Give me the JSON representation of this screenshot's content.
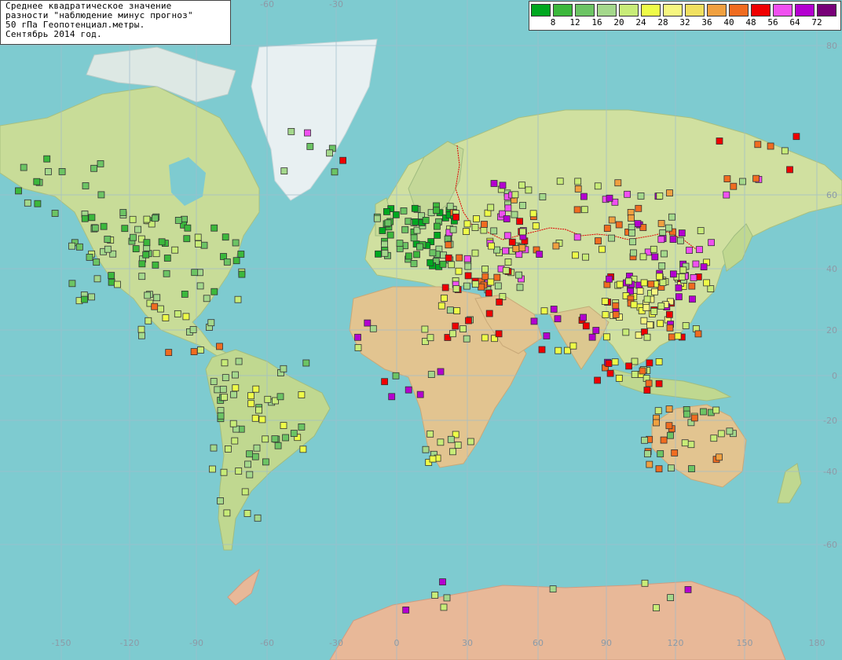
{
  "title": {
    "lines": [
      "Среднее квадратическое значение",
      "разности \"наблюдение минус прогноз\"",
      "50 гПа Геопотенциал.метры.",
      "Сентябрь 2014 год."
    ]
  },
  "legend": {
    "colors": [
      "#00a820",
      "#3cb83c",
      "#6cc464",
      "#a4d88c",
      "#c8ec78",
      "#eefc48",
      "#f6f680",
      "#f0e060",
      "#f0a040",
      "#f06c20",
      "#f00000",
      "#f050f0",
      "#b400d0",
      "#780078"
    ],
    "labels": [
      "8",
      "12",
      "16",
      "20",
      "24",
      "28",
      "32",
      "36",
      "40",
      "48",
      "56",
      "64",
      "72"
    ]
  },
  "axes": {
    "lon_labels": [
      "-150",
      "-120",
      "-90",
      "-60",
      "-30",
      "0",
      "30",
      "60",
      "90",
      "120",
      "150",
      "180"
    ],
    "lat_labels": [
      "80",
      "60",
      "40",
      "20",
      "0",
      "-20",
      "-40",
      "-60"
    ],
    "top_lon_labels": [
      "-60",
      "-30"
    ]
  },
  "colors": {
    "ocean": "#7ecbd0",
    "land": "#e8c48a",
    "highland": "#e4a890",
    "lowland": "#a8d890",
    "ice": "#e8f2f4",
    "border": "#e00000",
    "grid": "#9fbccc"
  },
  "stations_note": ""
}
